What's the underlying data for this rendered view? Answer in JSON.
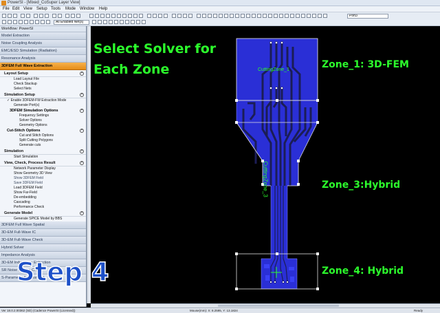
{
  "window": {
    "title": "PowerSI - [Mixed_CoSuper Layer View]"
  },
  "menu": [
    "File",
    "Edit",
    "View",
    "Setup",
    "Tools",
    "Mode",
    "Window",
    "Help"
  ],
  "toolbar": {
    "layer_select": "All Enabled Net(s)",
    "port_select": "Port3"
  },
  "workflow": {
    "header": "Workflow: PowerSI",
    "collapsed_top": [
      "Model Extraction",
      "Noise Coupling Analysis",
      "EMC/ESD Simulation (Radiation)",
      "Resonance Analysis"
    ],
    "active_panel": "3DFEM Full Wave Extraction",
    "sections": [
      {
        "title": "Layout Setup",
        "items": [
          "Load Layout File",
          "Check Stackup",
          "Select Nets"
        ]
      },
      {
        "title": "Simulation Setup",
        "items": [
          "✓ Enable 3DFEM-FW Extraction Mode",
          "Generate Port(s)"
        ],
        "subsections": [
          {
            "title": "3DFEM Simulation Options",
            "items": [
              "Frequency Settings",
              "Solver Options",
              "Geometry Options"
            ]
          },
          {
            "title": "Cut-Stitch Options",
            "items": [
              "Cut and Stitch Options",
              "Split Cutting Polygons",
              "Generate cuts"
            ]
          }
        ]
      },
      {
        "title": "Simulation",
        "items": [
          "Start Simulation"
        ]
      },
      {
        "title": "View, Check, Process Result",
        "items": [
          "Network Parameter Display",
          "Show Geometry 3D View",
          "Show 3DFEM Field",
          "Save 3DFEM Field",
          "Load 3DFEM Field",
          "Show Far-Field",
          "De-embedding",
          "Cascading",
          "Performance Check"
        ]
      },
      {
        "title": "Generate Model",
        "items": [
          "Generate SPICE Model by BBS"
        ]
      }
    ],
    "collapsed_bottom": [
      "3DFEM Full Wave Spatial",
      "3D-EM Full-Wave IC",
      "3D-EM Full-Wave Check",
      "Hybrid Solver",
      "Impedance Analysis",
      "3D-EM Inductance Extraction",
      "SR Noise Metrics Check",
      "S-Parameter Assessment"
    ]
  },
  "overlay": {
    "step_label": "Step 4"
  },
  "canvas": {
    "heading_line1": "Select Solver for",
    "heading_line2": "Each Zone",
    "zones": {
      "zone1": "Zone_1: 3D-FEM",
      "zone3": "Zone_3:Hybrid",
      "zone4": "Zone_4: Hybrid"
    },
    "cut_labels": {
      "cut1": "CuttingZone_1",
      "cut3": "CuttingZone_3"
    },
    "colors": {
      "board": "#2a2fd6",
      "trace": "#1a1c4a",
      "text_green": "#2cff2c",
      "outline": "#d8d8d8"
    }
  },
  "status": {
    "version": "Ver 18.0.2.00362  (SD) (Cadence PowerSI (Licensed))",
    "mouse": "Mouse(mm): X: 8.2595, Y: 13.1824",
    "ready": "Ready"
  }
}
